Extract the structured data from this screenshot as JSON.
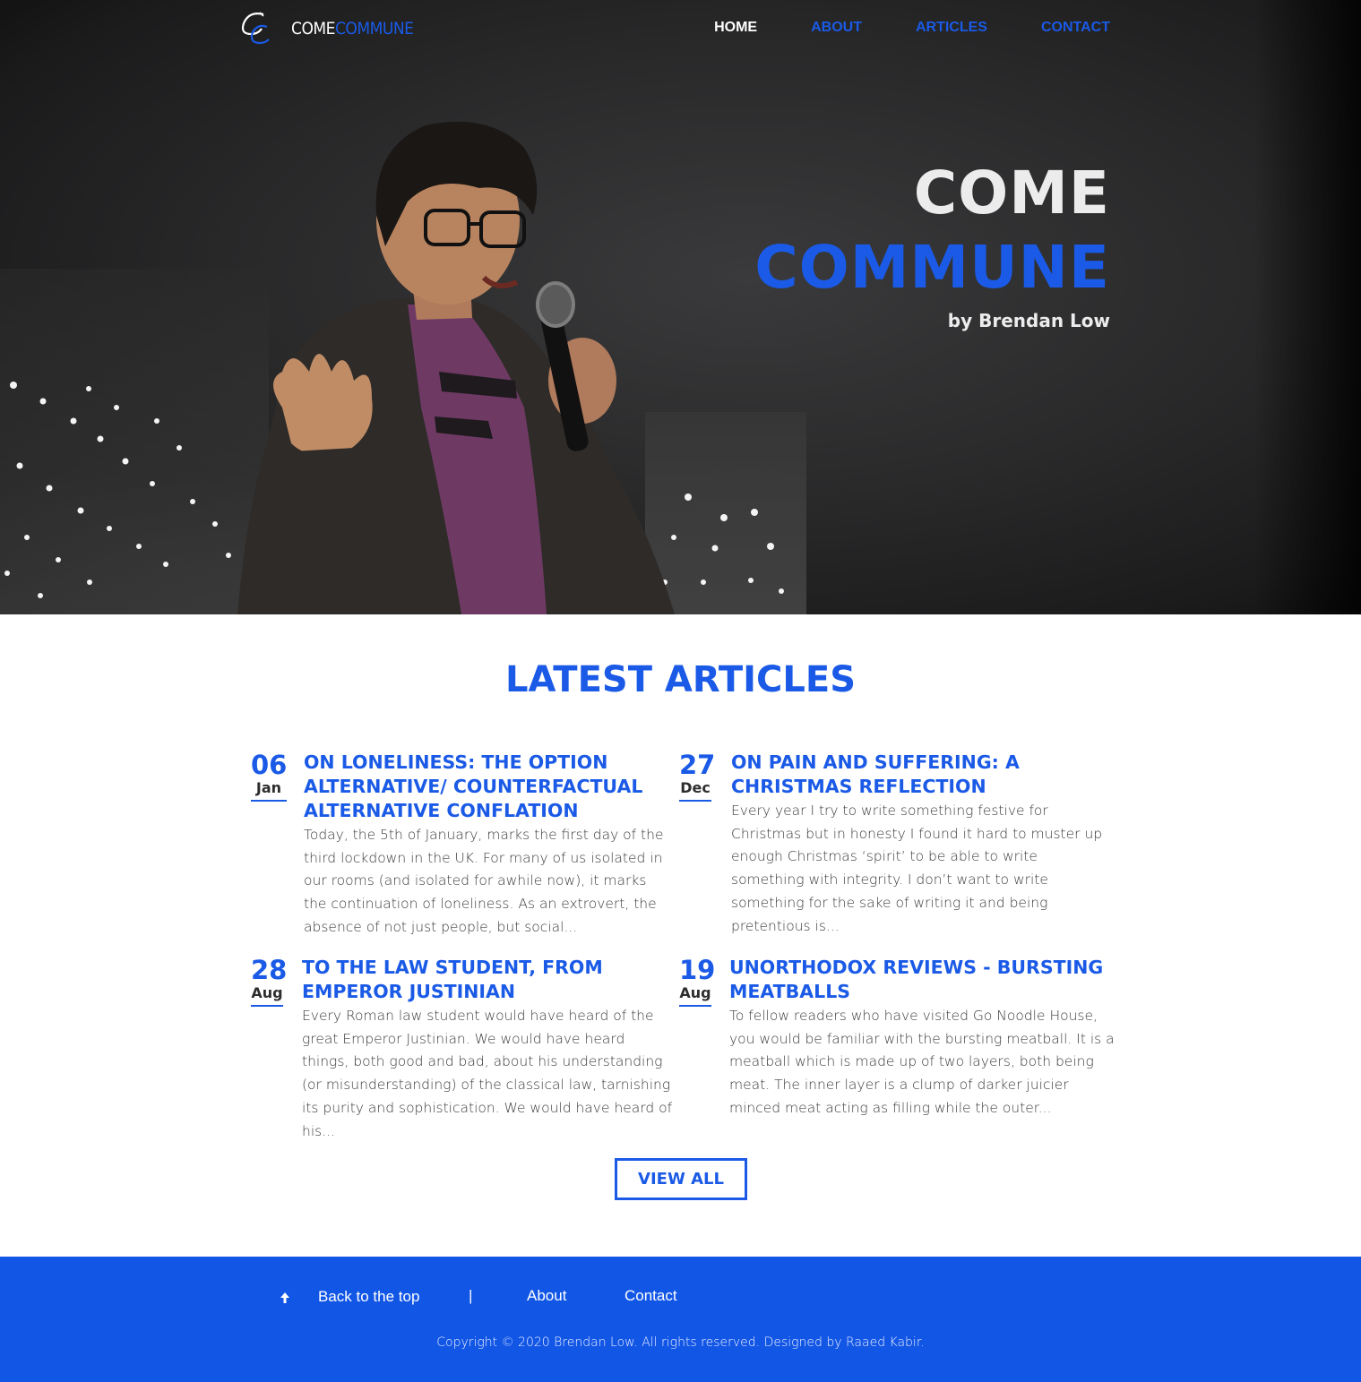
{
  "brand": {
    "logo_white": "COME",
    "logo_blue": "COMMUNE"
  },
  "nav": {
    "items": [
      {
        "label": "HOME",
        "active": true
      },
      {
        "label": "ABOUT",
        "active": false
      },
      {
        "label": "ARTICLES",
        "active": false
      },
      {
        "label": "CONTACT",
        "active": false
      }
    ]
  },
  "hero": {
    "line1": "COME",
    "line2": "COMMUNE",
    "byline": "by Brendan Low"
  },
  "latest": {
    "heading": "LATEST ARTICLES",
    "articles": [
      {
        "day": "06",
        "month": "Jan",
        "title": "ON LONELINESS: THE OPTION ALTERNATIVE/ COUNTERFACTUAL ALTERNATIVE CONFLATION",
        "excerpt": "Today, the 5th of January, marks the first day of the third lockdown in the UK. For many of us isolated in our rooms (and isolated for awhile now), it marks the continuation of loneliness. As an extrovert, the absence of not just people, but social..."
      },
      {
        "day": "27",
        "month": "Dec",
        "title": "ON PAIN AND SUFFERING: A CHRISTMAS REFLECTION",
        "excerpt": "Every year I try to write something festive for Christmas but in honesty I found it hard to muster up enough Christmas ‘spirit’ to be able to write something with integrity. I don’t want to write something for the sake of writing it and being pretentious is..."
      },
      {
        "day": "28",
        "month": "Aug",
        "title": "TO THE LAW STUDENT, FROM EMPEROR JUSTINIAN",
        "excerpt": "Every Roman law student would have heard of the great Emperor Justinian. We would have heard things, both good and bad, about his understanding (or misunderstanding) of the classical law, tarnishing its purity and sophistication. We would have heard of his..."
      },
      {
        "day": "19",
        "month": "Aug",
        "title": "UNORTHODOX REVIEWS - BURSTING MEATBALLS",
        "excerpt": "To fellow readers who have visited Go Noodle House, you would be familiar with the bursting meatball. It is a meatball which is made up of two layers, both being meat. The inner layer is a clump of darker juicier minced meat acting as filling while the outer..."
      }
    ],
    "view_all": "VIEW ALL"
  },
  "footer": {
    "back_to_top": "Back to the top",
    "separator": "|",
    "about": "About",
    "contact": "Contact",
    "copyright": "Copyright © 2020 Brendan Low. All rights reserved. Designed by Raaed Kabir."
  },
  "colors": {
    "accent": "#1a5ae6",
    "footer_bg": "#1256e6",
    "hero_text": "#ececec"
  },
  "icons": {
    "back_to_top": "arrow-up-icon",
    "logo": "cc-script-logo"
  }
}
